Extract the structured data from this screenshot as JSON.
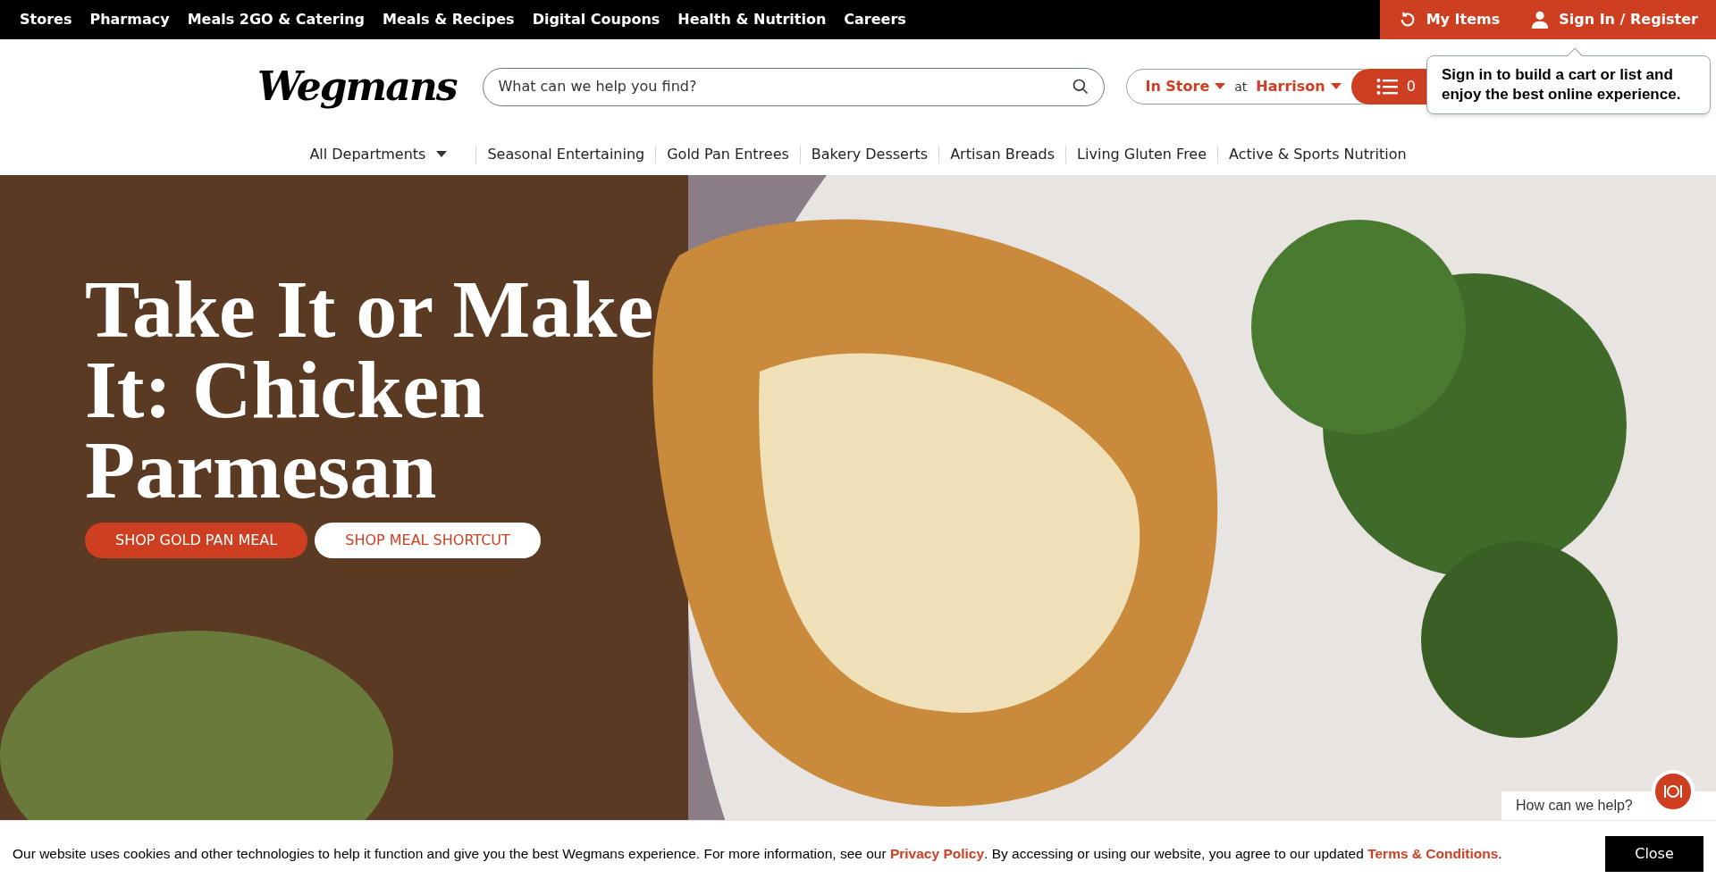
{
  "top_nav": [
    "Stores",
    "Pharmacy",
    "Meals 2GO & Catering",
    "Meals & Recipes",
    "Digital Coupons",
    "Health & Nutrition",
    "Careers"
  ],
  "account": {
    "my_items": "My Items",
    "sign_in": "Sign In / Register"
  },
  "logo": "Wegmans",
  "search": {
    "placeholder": "What can we help you find?"
  },
  "store": {
    "mode": "In Store",
    "at": "at",
    "location": "Harrison"
  },
  "cart": {
    "count": "0"
  },
  "tooltip": "Sign in to build a cart or list and enjoy the best online experience.",
  "departments": {
    "label": "All Departments",
    "items": [
      "Seasonal Entertaining",
      "Gold Pan Entrees",
      "Bakery Desserts",
      "Artisan Breads",
      "Living Gluten Free",
      "Active & Sports Nutrition"
    ]
  },
  "hero": {
    "title": "Take It or Make It: Chicken Parmesan",
    "buttons": [
      {
        "label": "SHOP GOLD PAN MEAL",
        "kind": "primary"
      },
      {
        "label": "SHOP MEAL SHORTCUT",
        "kind": "secondary"
      }
    ]
  },
  "chat": {
    "label": "How can we help?"
  },
  "cookie": {
    "text_1": "Our website uses cookies and other technologies to help it function and give you the best Wegmans experience. For more information, see our ",
    "link_1": "Privacy Policy",
    "text_2": ". By accessing or using our website, you agree to our updated ",
    "link_2": "Terms & Conditions",
    "text_3": ".",
    "close": "Close"
  }
}
